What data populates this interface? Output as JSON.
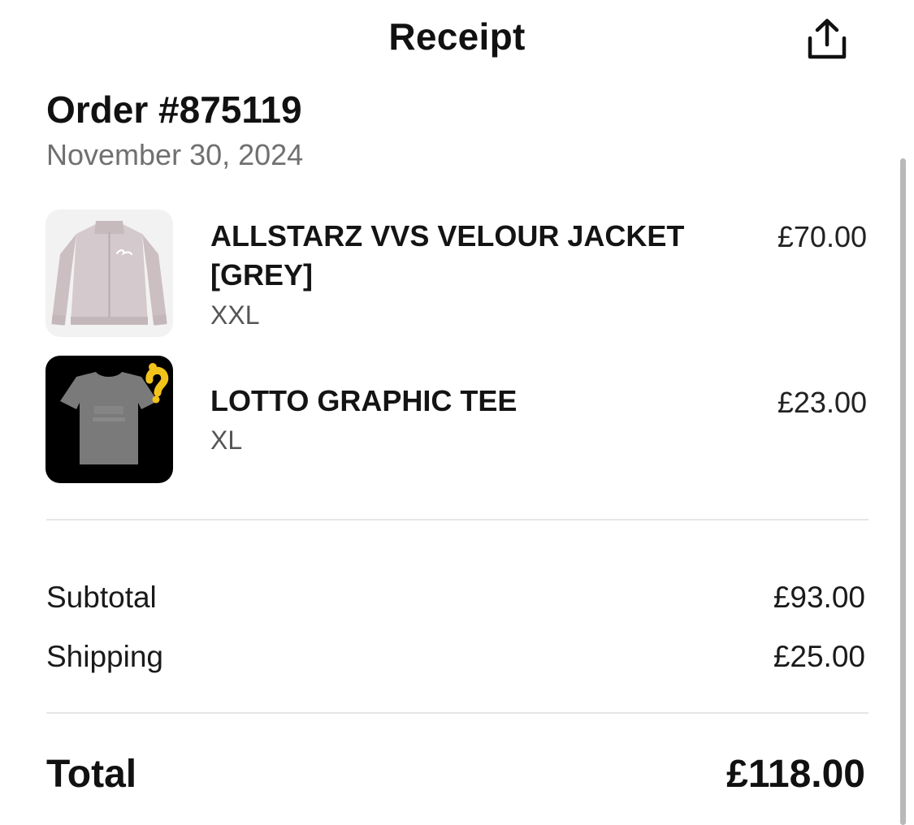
{
  "header": {
    "title": "Receipt",
    "share_icon": "share-icon"
  },
  "order": {
    "number": "Order #875119",
    "date": "November 30, 2024"
  },
  "items": [
    {
      "name": "ALLSTARZ VVS VELOUR JACKET [GREY]",
      "variant": "XXL",
      "price": "£70.00",
      "thumbnail_icon": "grey-velour-jacket-image"
    },
    {
      "name": "LOTTO GRAPHIC TEE",
      "variant": "XL",
      "price": "£23.00",
      "thumbnail_icon": "grey-graphic-tee-image"
    }
  ],
  "summary": {
    "subtotal_label": "Subtotal",
    "subtotal_value": "£93.00",
    "shipping_label": "Shipping",
    "shipping_value": "£25.00",
    "total_label": "Total",
    "total_value": "£118.00"
  },
  "colors": {
    "text_primary": "#111111",
    "text_secondary": "#707070",
    "divider": "#e6e6e6",
    "scrollbar": "#b9b9b9"
  }
}
